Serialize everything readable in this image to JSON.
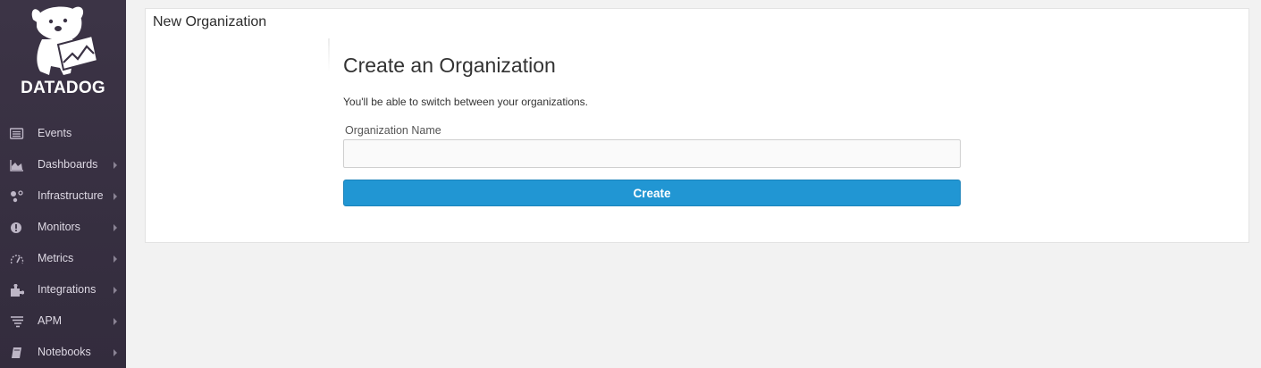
{
  "brand": {
    "name": "DATADOG",
    "logo_icon": "datadog-dog-logo"
  },
  "sidebar": {
    "items": [
      {
        "label": "Events",
        "icon": "events-list-icon",
        "has_submenu": false
      },
      {
        "label": "Dashboards",
        "icon": "dashboard-area-chart-icon",
        "has_submenu": true
      },
      {
        "label": "Infrastructure",
        "icon": "infrastructure-nodes-icon",
        "has_submenu": true
      },
      {
        "label": "Monitors",
        "icon": "monitor-alert-icon",
        "has_submenu": true
      },
      {
        "label": "Metrics",
        "icon": "metrics-gauge-icon",
        "has_submenu": true
      },
      {
        "label": "Integrations",
        "icon": "integrations-puzzle-icon",
        "has_submenu": true
      },
      {
        "label": "APM",
        "icon": "apm-lines-icon",
        "has_submenu": true
      },
      {
        "label": "Notebooks",
        "icon": "notebook-icon",
        "has_submenu": true
      }
    ]
  },
  "page": {
    "title": "New Organization",
    "form": {
      "heading": "Create an Organization",
      "subtitle": "You'll be able to switch between your organizations.",
      "name_label": "Organization Name",
      "name_value": "",
      "name_placeholder": "",
      "submit_label": "Create"
    }
  },
  "colors": {
    "sidebar_bg": "#3a3244",
    "primary_button": "#2196d3",
    "page_bg": "#f2f2f2"
  }
}
